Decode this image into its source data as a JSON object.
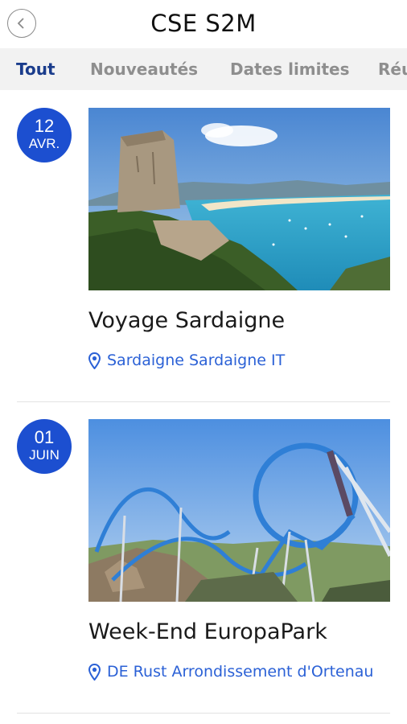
{
  "header": {
    "title": "CSE S2M"
  },
  "tabs": [
    {
      "label": "Tout"
    },
    {
      "label": "Nouveautés"
    },
    {
      "label": "Dates limites"
    },
    {
      "label": "Réu"
    }
  ],
  "events": [
    {
      "day": "12",
      "month": "AVR.",
      "title": "Voyage Sardaigne",
      "location": "Sardaigne Sardaigne IT"
    },
    {
      "day": "01",
      "month": "JUIN",
      "title": "Week-End EuropaPark",
      "location": "DE Rust Arrondissement d'Ortenau"
    }
  ],
  "colors": {
    "accent": "#1c4fd0",
    "link": "#2b61d6",
    "active_tab": "#1a3c8c"
  },
  "icons": {
    "back": "chevron-left-icon",
    "location": "map-pin-icon"
  }
}
